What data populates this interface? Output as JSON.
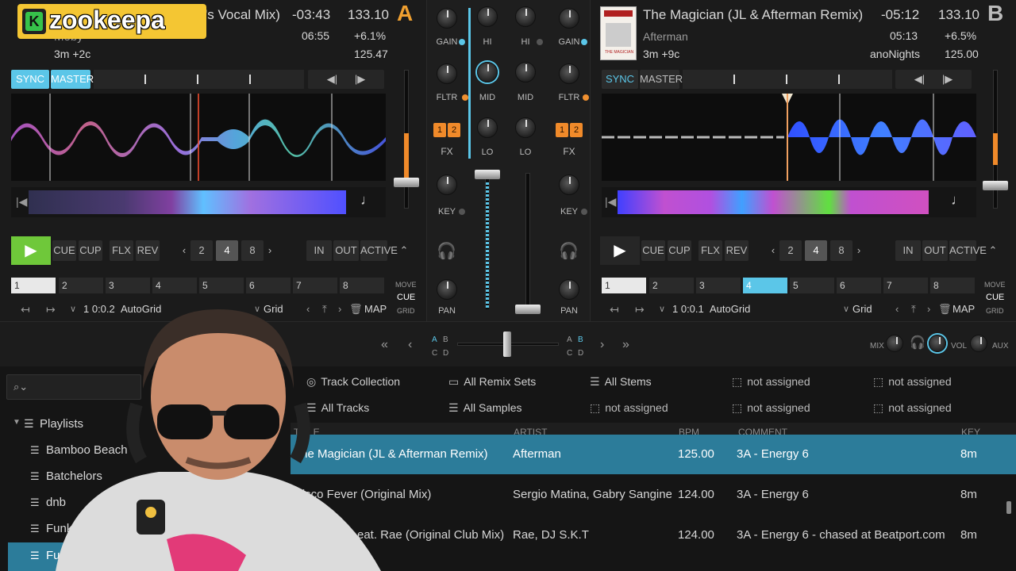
{
  "overlay": {
    "logo_text": "zookeepa",
    "logo_letter": "K"
  },
  "deckA": {
    "letter": "A",
    "title_partial": "'s Vocal Mix)",
    "artist": "Moby",
    "key_info": "3m +2c",
    "remaining": "-03:43",
    "elapsed": "06:55",
    "bpm": "133.10",
    "pitch": "+6.1%",
    "base_bpm": "125.47",
    "sync_label": "SYNC",
    "master_label": "MASTER",
    "cue_label": "CUE",
    "cup_label": "CUP",
    "flx_label": "FLX",
    "rev_label": "REV",
    "loop_sizes": [
      "2",
      "4",
      "8"
    ],
    "in_label": "IN",
    "out_label": "OUT",
    "active_label": "ACTIVE",
    "hotcues": [
      "1",
      "2",
      "3",
      "4",
      "5",
      "6",
      "7",
      "8"
    ],
    "move_label": "MOVE",
    "move_mode": "CUE",
    "grid_small": "GRID",
    "beat_pos": "1 0:0.2",
    "autogrid_label": "AutoGrid",
    "grid_label": "Grid",
    "map_label": "MAP"
  },
  "deckB": {
    "letter": "B",
    "title": "The Magician (JL & Afterman Remix)",
    "artist": "Afterman",
    "key_info": "3m +9c",
    "label": "anoNights",
    "remaining": "-05:12",
    "elapsed": "05:13",
    "bpm": "133.10",
    "pitch": "+6.5%",
    "base_bpm": "125.00",
    "sync_label": "SYNC",
    "master_label": "MASTER",
    "cue_label": "CUE",
    "cup_label": "CUP",
    "flx_label": "FLX",
    "rev_label": "REV",
    "loop_sizes": [
      "2",
      "4",
      "8"
    ],
    "in_label": "IN",
    "out_label": "OUT",
    "active_label": "ACTIVE",
    "hotcues": [
      "1",
      "2",
      "3",
      "4",
      "5",
      "6",
      "7",
      "8"
    ],
    "move_label": "MOVE",
    "move_mode": "CUE",
    "grid_small": "GRID",
    "beat_pos": "1 0:0.1",
    "autogrid_label": "AutoGrid",
    "grid_label": "Grid",
    "map_label": "MAP",
    "cover_text": "THE MAGICIAN"
  },
  "mixer": {
    "gain": "GAIN",
    "hi": "HI",
    "mid": "MID",
    "lo": "LO",
    "fltr": "FLTR",
    "fx": "FX",
    "key": "KEY",
    "pan": "PAN",
    "fx1": "1",
    "fx2": "2"
  },
  "xfader": {
    "a": "A",
    "b": "B",
    "c": "C",
    "d": "D"
  },
  "master": {
    "mix": "MIX",
    "vol": "VOL",
    "aux": "AUX"
  },
  "browser": {
    "playlists_label": "Playlists",
    "playlists": [
      "Bamboo Beach",
      "Batchelors",
      "dnb",
      "Funk",
      "Fu"
    ],
    "shortcuts": [
      "Track Collection",
      "All Remix Sets",
      "All Stems",
      "not assigned",
      "not assigned",
      "All Tracks",
      "All Samples",
      "not assigned",
      "not assigned",
      "not assigned"
    ],
    "columns": [
      "TITLE",
      "ARTIST",
      "BPM",
      "COMMENT",
      "KEY"
    ],
    "tracks": [
      {
        "title": "The Magician (JL & Afterman Remix)",
        "artist": "Afterman",
        "bpm": "125.00",
        "comment": "3A - Energy 6",
        "key": "8m"
      },
      {
        "title": "Disco Fever (Original Mix)",
        "artist": "Sergio Matina, Gabry Sangineto",
        "bpm": "124.00",
        "comment": "3A - Energy 6",
        "key": "8m"
      },
      {
        "title": "eat. Rae (Original Club Mix)",
        "artist": "Rae, DJ S.K.T",
        "bpm": "124.00",
        "comment": "3A - Energy 6 - chased at Beatport.com",
        "key": "8m"
      }
    ]
  },
  "colors": {
    "accent": "#5bc6e8",
    "deck_letter": "#f0a030",
    "play": "#6fc83a",
    "fx": "#f08a2a",
    "selected_row": "#2c7c9a"
  }
}
